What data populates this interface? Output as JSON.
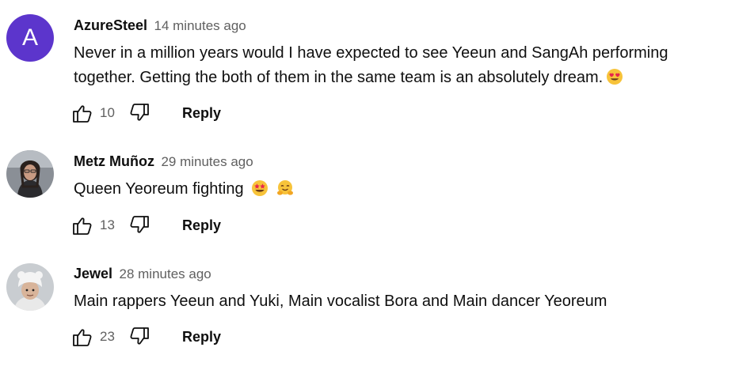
{
  "comments": [
    {
      "avatar_letter": "A",
      "author": "AzureSteel",
      "time": "14 minutes ago",
      "text_line1": "Never in a million years would I have expected to see Yeeun and SangAh performing",
      "text_line2": "together. Getting the both of them in the same team is an absolutely dream.",
      "emojis": [
        "heart-eyes-emoji"
      ],
      "likes": "10",
      "reply_label": "Reply"
    },
    {
      "author": "Metz Muñoz",
      "time": "29 minutes ago",
      "text_line1": "Queen Yeoreum fighting",
      "emojis": [
        "star-struck-emoji",
        "hugging-face-emoji"
      ],
      "likes": "13",
      "reply_label": "Reply"
    },
    {
      "author": "Jewel",
      "time": "28 minutes ago",
      "text_line1": "Main rappers Yeeun and Yuki, Main vocalist Bora and Main dancer Yeoreum",
      "likes": "23",
      "reply_label": "Reply"
    }
  ],
  "icons": {
    "like": "thumbs-up-icon",
    "dislike": "thumbs-down-icon"
  },
  "colors": {
    "avatar_letter_bg": "#5c35cc",
    "secondary_text": "#606060",
    "primary_text": "#0f0f0f"
  }
}
